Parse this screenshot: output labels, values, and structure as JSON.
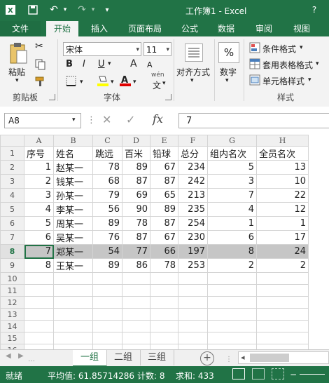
{
  "titlebar": {
    "title": "工作簿1 - Excel",
    "save_icon": "save-icon",
    "undo_icon": "undo-icon",
    "redo_icon": "redo-icon",
    "help": "?"
  },
  "ribbon_tabs": [
    "文件",
    "开始",
    "插入",
    "页面布局",
    "公式",
    "数据",
    "审阅",
    "视图"
  ],
  "clipboard": {
    "paste": "粘贴",
    "label": "剪贴板"
  },
  "font": {
    "name": "宋体",
    "size": "11",
    "label": "字体",
    "bold": "B",
    "italic": "I",
    "underline": "U",
    "grow": "A",
    "shrink": "A",
    "wen": "wén",
    "wen_char": "文"
  },
  "alignment": {
    "label": "对齐方式"
  },
  "number": {
    "label": "数字",
    "percent": "%"
  },
  "styles": {
    "cond_format": "条件格式",
    "table_format": "套用表格格式",
    "cell_styles": "单元格样式",
    "label": "样式"
  },
  "formula_bar": {
    "name_box": "A8",
    "value": "7",
    "fx": "fx"
  },
  "columns": [
    "A",
    "B",
    "C",
    "D",
    "E",
    "F",
    "G",
    "H"
  ],
  "header_row": [
    "序号",
    "姓名",
    "跳远",
    "百米",
    "铅球",
    "总分",
    "组内名次",
    "全员名次"
  ],
  "rows": [
    [
      "1",
      "赵某一",
      "78",
      "89",
      "67",
      "234",
      "5",
      "13"
    ],
    [
      "2",
      "钱某一",
      "68",
      "87",
      "87",
      "242",
      "3",
      "10"
    ],
    [
      "3",
      "孙某一",
      "79",
      "69",
      "65",
      "213",
      "7",
      "22"
    ],
    [
      "4",
      "李某一",
      "56",
      "90",
      "89",
      "235",
      "4",
      "12"
    ],
    [
      "5",
      "周某一",
      "89",
      "78",
      "87",
      "254",
      "1",
      "1"
    ],
    [
      "6",
      "吴某一",
      "76",
      "87",
      "67",
      "230",
      "6",
      "17"
    ],
    [
      "7",
      "郑某一",
      "54",
      "77",
      "66",
      "197",
      "8",
      "24"
    ],
    [
      "8",
      "王某一",
      "89",
      "86",
      "78",
      "253",
      "2",
      "2"
    ]
  ],
  "row_numbers": [
    "1",
    "2",
    "3",
    "4",
    "5",
    "6",
    "7",
    "8",
    "9",
    "10",
    "11",
    "12",
    "13",
    "14",
    "15",
    "16"
  ],
  "sheets": [
    "一组",
    "二组",
    "三组"
  ],
  "add_sheet": "+",
  "status": {
    "ready": "就绪",
    "average": "平均值: 61.85714286",
    "count": "计数: 8",
    "sum": "求和: 433"
  },
  "colors": {
    "accent": "#217346"
  }
}
